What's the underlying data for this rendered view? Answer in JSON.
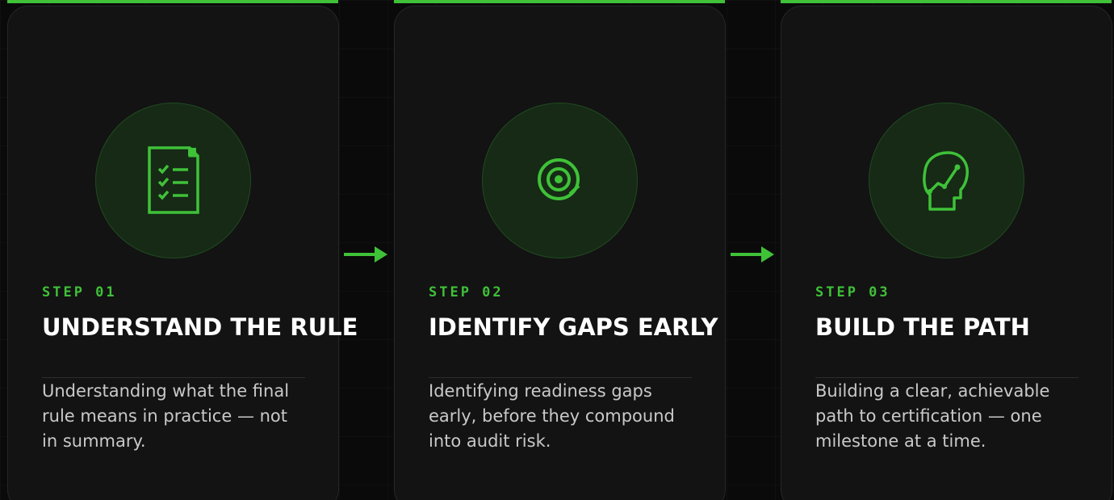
{
  "colors": {
    "accent": "#3fc138",
    "card_bg": "#131313",
    "page_bg": "#0a0a0a",
    "title": "#ffffff",
    "body_text": "#c9c9c9"
  },
  "steps": [
    {
      "label": "STEP 01",
      "title": "UNDERSTAND THE RULE",
      "description": "Understanding what the final rule means in practice — not in summary.",
      "icon": "checklist-document-icon"
    },
    {
      "label": "STEP 02",
      "title": "IDENTIFY GAPS EARLY",
      "description": "Identifying readiness gaps early, before they compound into audit risk.",
      "icon": "target-icon"
    },
    {
      "label": "STEP 03",
      "title": "BUILD THE PATH",
      "description": "Building a clear, achievable path to certification — one milestone at a time.",
      "icon": "growth-chart-head-icon"
    }
  ]
}
